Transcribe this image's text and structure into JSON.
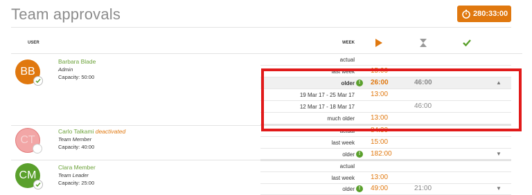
{
  "page": {
    "title": "Team approvals"
  },
  "timer": {
    "label": "280:33:00"
  },
  "table": {
    "headers": {
      "user": "USER",
      "week": "WEEK"
    },
    "header_icons": [
      "play-icon",
      "hourglass-icon",
      "check-icon"
    ]
  },
  "users": [
    {
      "initials": "BB",
      "name": "Barbara Blade",
      "status": "",
      "role": "Admin",
      "capacity": "Capacity: 50:00",
      "avatar_color": "#e0780f",
      "rows": [
        {
          "label": "actual",
          "v1": "",
          "v2": ""
        },
        {
          "label": "last week",
          "v1": "15:00",
          "v2": ""
        },
        {
          "label": "older",
          "v1": "26:00",
          "v2": "46:00"
        },
        {
          "label": "19 Mar 17 - 25 Mar 17",
          "v1": "13:00",
          "v2": ""
        },
        {
          "label": "12 Mar 17 - 18 Mar 17",
          "v1": "",
          "v2": "46:00"
        },
        {
          "label": "much older",
          "v1": "13:00",
          "v2": ""
        }
      ]
    },
    {
      "initials": "CT",
      "name": "Carlo Talkami",
      "status": "deactivated",
      "role": "Team Member",
      "capacity": "Capacity: 40:00",
      "avatar_color": "#f2a6a6",
      "rows": [
        {
          "label": "actual",
          "v1": "84:30",
          "v2": ""
        },
        {
          "label": "last week",
          "v1": "15:00",
          "v2": ""
        },
        {
          "label": "older",
          "v1": "182:00",
          "v2": ""
        }
      ]
    },
    {
      "initials": "CM",
      "name": "Clara Member",
      "status": "",
      "role": "Team Leader",
      "capacity": "Capacity: 25:00",
      "avatar_color": "#5aa02c",
      "rows": [
        {
          "label": "actual",
          "v1": "",
          "v2": ""
        },
        {
          "label": "last week",
          "v1": "13:00",
          "v2": ""
        },
        {
          "label": "older",
          "v1": "49:00",
          "v2": "21:00"
        }
      ]
    }
  ]
}
